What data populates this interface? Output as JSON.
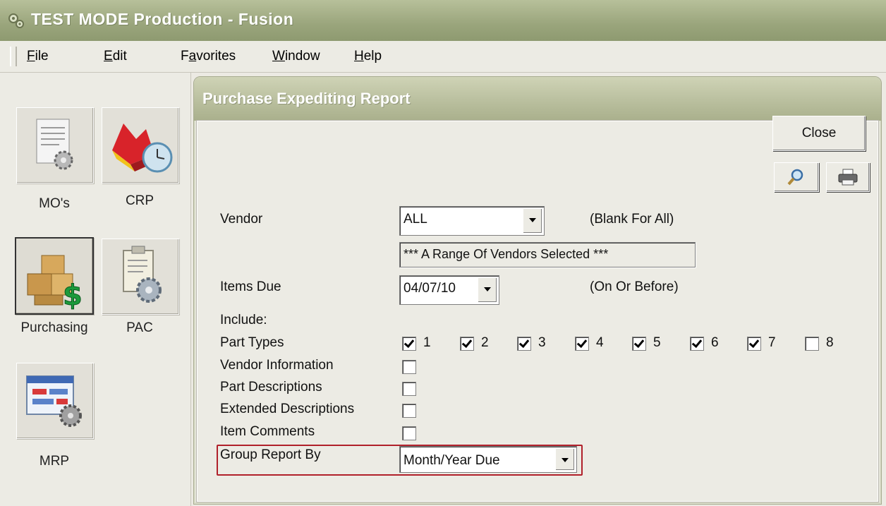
{
  "window": {
    "title": "TEST MODE Production - Fusion"
  },
  "menu": [
    {
      "pre": "",
      "ul": "F",
      "post": "ile"
    },
    {
      "pre": "",
      "ul": "E",
      "post": "dit"
    },
    {
      "pre": "F",
      "ul": "a",
      "post": "vorites"
    },
    {
      "pre": "",
      "ul": "W",
      "post": "indow"
    },
    {
      "pre": "",
      "ul": "H",
      "post": "elp"
    }
  ],
  "modules": [
    {
      "label": "MO's"
    },
    {
      "label": "CRP"
    },
    {
      "label": "Purchasing"
    },
    {
      "label": "PAC"
    },
    {
      "label": "MRP"
    }
  ],
  "dialog": {
    "title": "Purchase Expediting Report",
    "close_label": "Close",
    "vendor": {
      "label": "Vendor",
      "value": "ALL",
      "hint": "(Blank For All)",
      "range_text": "*** A Range Of Vendors Selected ***"
    },
    "items_due": {
      "label": "Items Due",
      "value": "04/07/10",
      "hint": "(On Or Before)"
    },
    "include_label": "Include:",
    "part_types": {
      "label": "Part Types",
      "options": [
        {
          "num": "1",
          "checked": true
        },
        {
          "num": "2",
          "checked": true
        },
        {
          "num": "3",
          "checked": true
        },
        {
          "num": "4",
          "checked": true
        },
        {
          "num": "5",
          "checked": true
        },
        {
          "num": "6",
          "checked": true
        },
        {
          "num": "7",
          "checked": true
        },
        {
          "num": "8",
          "checked": false
        }
      ]
    },
    "options": [
      {
        "label": "Vendor Information",
        "checked": false
      },
      {
        "label": "Part Descriptions",
        "checked": false
      },
      {
        "label": "Extended Descriptions",
        "checked": false
      },
      {
        "label": "Item Comments",
        "checked": false
      }
    ],
    "group_by": {
      "label": "Group Report By",
      "value": "Month/Year Due"
    }
  },
  "colors": {
    "highlight": "#b0202a",
    "titlebar": "#9aa57c"
  }
}
